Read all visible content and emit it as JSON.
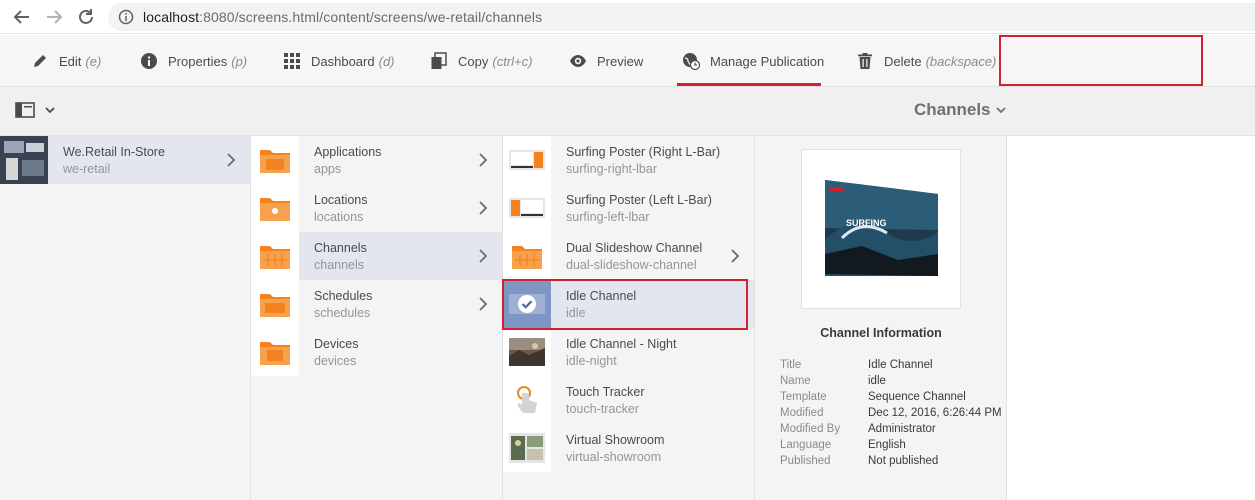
{
  "browser": {
    "url_host": "localhost",
    "url_rest": ":8080/screens.html/content/screens/we-retail/channels"
  },
  "toolbar": {
    "edit": {
      "label": "Edit",
      "shortcut": "(e)"
    },
    "properties": {
      "label": "Properties",
      "shortcut": "(p)"
    },
    "dashboard": {
      "label": "Dashboard",
      "shortcut": "(d)"
    },
    "copy": {
      "label": "Copy",
      "shortcut": "(ctrl+c)"
    },
    "preview": {
      "label": "Preview"
    },
    "manage_publication": {
      "label": "Manage Publication"
    },
    "delete": {
      "label": "Delete",
      "shortcut": "(backspace)"
    }
  },
  "titlebar": {
    "title": "Channels"
  },
  "column1": [
    {
      "title": "We.Retail In-Store",
      "sub": "we-retail"
    }
  ],
  "column2": [
    {
      "title": "Applications",
      "sub": "apps"
    },
    {
      "title": "Locations",
      "sub": "locations"
    },
    {
      "title": "Channels",
      "sub": "channels"
    },
    {
      "title": "Schedules",
      "sub": "schedules"
    },
    {
      "title": "Devices",
      "sub": "devices"
    }
  ],
  "column3": [
    {
      "title": "Surfing Poster (Right L-Bar)",
      "sub": "surfing-right-lbar"
    },
    {
      "title": "Surfing Poster (Left L-Bar)",
      "sub": "surfing-left-lbar"
    },
    {
      "title": "Dual Slideshow Channel",
      "sub": "dual-slideshow-channel"
    },
    {
      "title": "Idle Channel",
      "sub": "idle"
    },
    {
      "title": "Idle Channel - Night",
      "sub": "idle-night"
    },
    {
      "title": "Touch Tracker",
      "sub": "touch-tracker"
    },
    {
      "title": "Virtual Showroom",
      "sub": "virtual-showroom"
    }
  ],
  "info": {
    "heading": "Channel Information",
    "preview_text": "SURFING",
    "rows": [
      {
        "k": "Title",
        "v": "Idle Channel"
      },
      {
        "k": "Name",
        "v": "idle"
      },
      {
        "k": "Template",
        "v": "Sequence Channel"
      },
      {
        "k": "Modified",
        "v": "Dec 12, 2016, 6:26:44 PM"
      },
      {
        "k": "Modified By",
        "v": "Administrator"
      },
      {
        "k": "Language",
        "v": "English"
      },
      {
        "k": "Published",
        "v": "Not published"
      }
    ]
  },
  "colors": {
    "accent_red": "#d2202f",
    "folder_orange": "#f58220",
    "selected_row": "#e3e6ee"
  }
}
